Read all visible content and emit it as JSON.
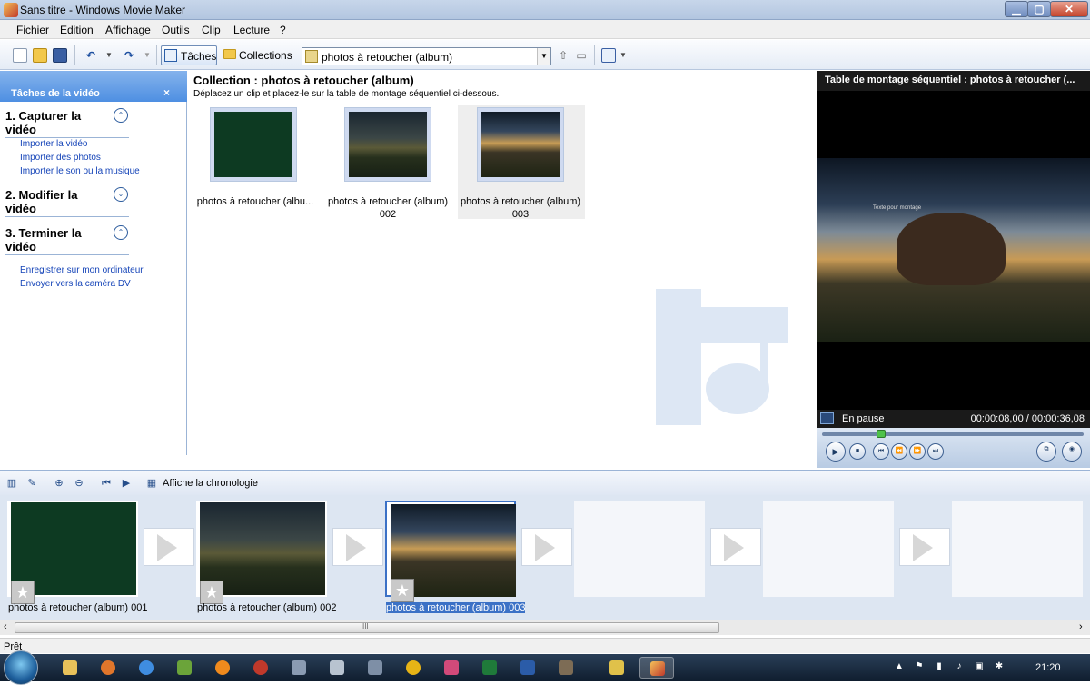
{
  "window": {
    "title": "Sans titre - Windows Movie Maker",
    "min": "▁",
    "max": "▢",
    "close": "✕"
  },
  "menu": [
    "Fichier",
    "Edition",
    "Affichage",
    "Outils",
    "Clip",
    "Lecture",
    "?"
  ],
  "toolbar": {
    "tasks_label": "Tâches",
    "collections_label": "Collections",
    "collection_select": "photos à retoucher (album)"
  },
  "taskpane": {
    "header": "Tâches de la vidéo",
    "close": "×",
    "sections": [
      {
        "title": "1. Capturer la vidéo",
        "toggle": "⌃",
        "links": [
          "Importer la vidéo",
          "Importer des photos",
          "Importer le son ou la musique"
        ]
      },
      {
        "title": "2. Modifier la vidéo",
        "toggle": "⌄",
        "links": []
      },
      {
        "title": "3. Terminer la vidéo",
        "toggle": "⌃",
        "links": [
          "Enregistrer sur mon ordinateur",
          "Envoyer vers la caméra DV"
        ]
      }
    ]
  },
  "collection": {
    "title": "Collection : photos à retoucher (album)",
    "subtitle": "Déplacez un clip et placez-le sur la table de montage séquentiel ci-dessous.",
    "clips": [
      {
        "label": "photos à retoucher (albu...",
        "label2": ""
      },
      {
        "label": "photos à retoucher (album)",
        "label2": "002"
      },
      {
        "label": "photos à retoucher (album)",
        "label2": "003"
      }
    ]
  },
  "monitor": {
    "title": "Table de montage séquentiel : photos à retoucher (...",
    "overlay": "Texte pour montage",
    "status": "En pause",
    "time": "00:00:08,00 / 00:00:36,08"
  },
  "storyboard": {
    "toolbar_label": "Affiche la chronologie",
    "clips": [
      "photos à retoucher (album) 001",
      "photos à retoucher (album) 002",
      "photos à retoucher (album) 003"
    ]
  },
  "scroll": {
    "grip": "III",
    "left": "‹",
    "right": "›"
  },
  "status": "Prêt",
  "taskbar": {
    "time": "21:20"
  }
}
